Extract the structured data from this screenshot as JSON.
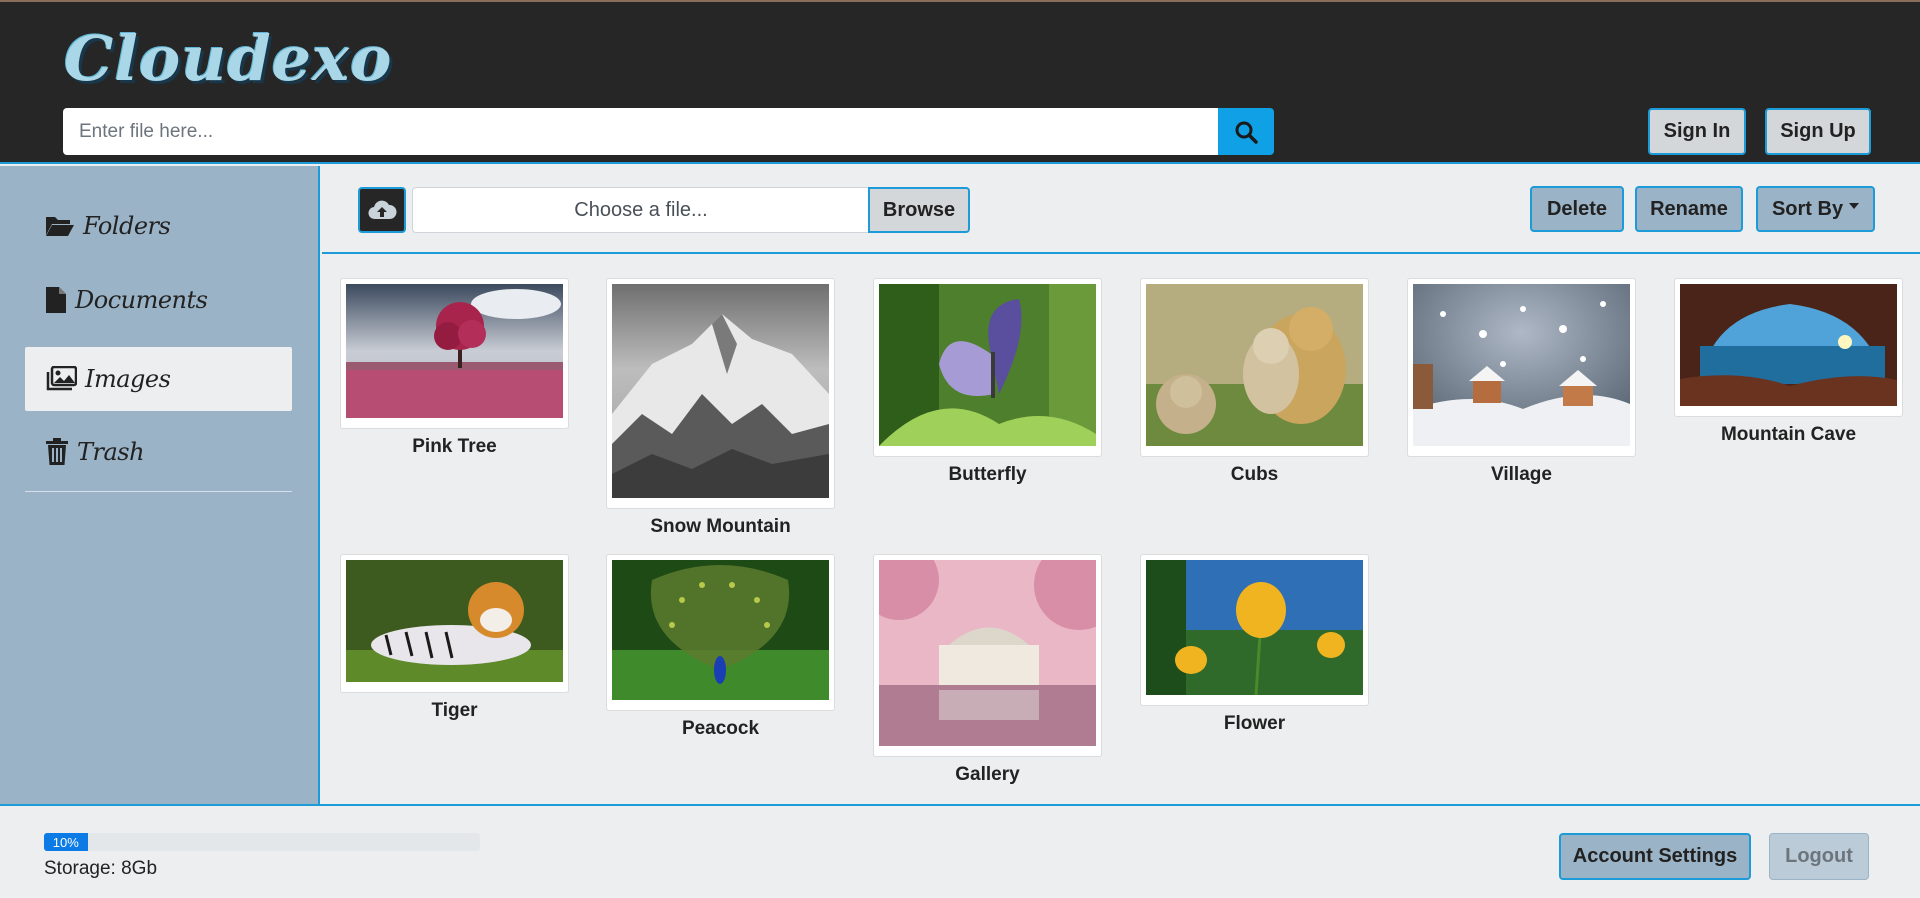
{
  "header": {
    "logo": "Cloudexo",
    "search_placeholder": "Enter file here...",
    "sign_in": "Sign In",
    "sign_up": "Sign Up"
  },
  "sidebar": {
    "items": [
      {
        "label": "Folders",
        "icon": "folder-open-icon"
      },
      {
        "label": "Documents",
        "icon": "file-icon"
      },
      {
        "label": "Images",
        "icon": "images-icon",
        "active": true
      },
      {
        "label": "Trash",
        "icon": "trash-icon"
      }
    ]
  },
  "toolbar": {
    "file_placeholder": "Choose a file...",
    "browse": "Browse",
    "delete": "Delete",
    "rename": "Rename",
    "sort_by": "Sort By"
  },
  "images": [
    {
      "caption": "Pink Tree"
    },
    {
      "caption": "Snow Mountain"
    },
    {
      "caption": "Butterfly"
    },
    {
      "caption": "Cubs"
    },
    {
      "caption": "Village"
    },
    {
      "caption": "Mountain Cave"
    },
    {
      "caption": "Tiger"
    },
    {
      "caption": "Peacock"
    },
    {
      "caption": "Gallery"
    },
    {
      "caption": "Flower"
    }
  ],
  "footer": {
    "progress_label": "10%",
    "progress_value": 0.1,
    "storage": "Storage: 8Gb",
    "account_settings": "Account Settings",
    "logout": "Logout"
  },
  "colors": {
    "accent": "#1d9bd8",
    "header_bg": "#262626",
    "sidebar_bg": "#9bb3c7",
    "search_button": "#0fa0e6",
    "progress": "#0d7be6"
  }
}
